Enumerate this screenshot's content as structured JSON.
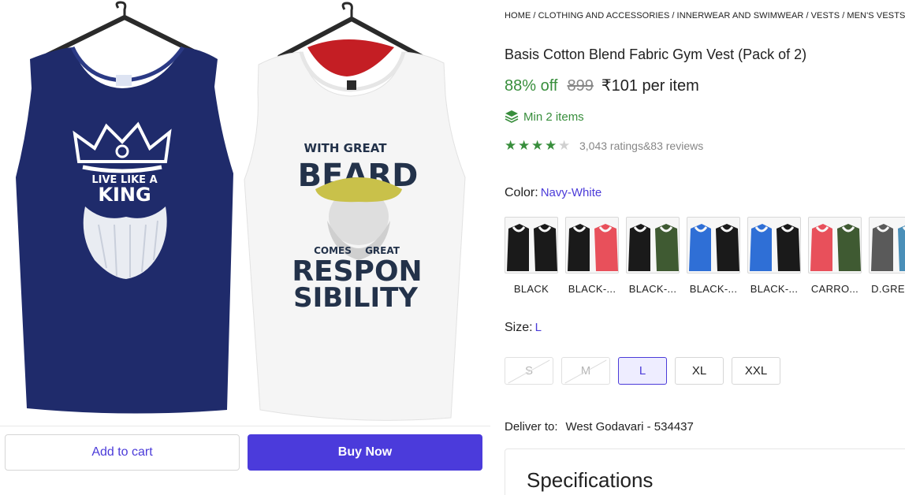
{
  "breadcrumb": [
    {
      "label": "HOME"
    },
    {
      "label": "CLOTHING AND ACCESSORIES"
    },
    {
      "label": "INNERWEAR AND SWIMWEAR"
    },
    {
      "label": "VESTS"
    },
    {
      "label": "MEN'S VESTS"
    }
  ],
  "product": {
    "title": "Basis Cotton Blend Fabric Gym Vest (Pack of 2)",
    "discount": "88% off",
    "mrp": "899",
    "price": "₹101 per item",
    "min_items": "Min 2 items",
    "rating": 4,
    "rating_max": 5,
    "ratings_count": "3,043 ratings",
    "reviews_count": "83 reviews",
    "reviews_prefix": "&"
  },
  "image": {
    "left_vest": {
      "text_top": "LIVE LIKE A",
      "text_bottom": "KING",
      "color": "#1f2b6b"
    },
    "right_vest": {
      "line1": "WITH GREAT",
      "line2": "BEARD",
      "line3": "COMES",
      "line4": "GREAT",
      "line5": "RESPON",
      "line6": "SIBILITY",
      "color": "#f5f5f5"
    }
  },
  "actions": {
    "add_to_cart": "Add to cart",
    "buy_now": "Buy Now"
  },
  "color": {
    "label": "Color:",
    "selected": "Navy-White",
    "options": [
      {
        "label": "BLACK",
        "c1": "#1a1a1a",
        "c2": "#1a1a1a"
      },
      {
        "label": "BLACK-...",
        "c1": "#1a1a1a",
        "c2": "#e8505b"
      },
      {
        "label": "BLACK-...",
        "c1": "#1a1a1a",
        "c2": "#3f5a32"
      },
      {
        "label": "BLACK-...",
        "c1": "#2f6fd6",
        "c2": "#1a1a1a"
      },
      {
        "label": "BLACK-...",
        "c1": "#2f6fd6",
        "c2": "#1a1a1a"
      },
      {
        "label": "CARRO...",
        "c1": "#e8505b",
        "c2": "#3f5a32"
      },
      {
        "label": "D.GREY...",
        "c1": "#5a5a5a",
        "c2": "#4a8fb8"
      }
    ]
  },
  "size": {
    "label": "Size:",
    "selected": "L",
    "options": [
      {
        "label": "S",
        "state": "disabled"
      },
      {
        "label": "M",
        "state": "disabled"
      },
      {
        "label": "L",
        "state": "selected"
      },
      {
        "label": "XL",
        "state": "available"
      },
      {
        "label": "XXL",
        "state": "available"
      }
    ]
  },
  "delivery": {
    "label": "Deliver to:",
    "location": "West Godavari - 534437"
  },
  "specifications": {
    "title": "Specifications"
  },
  "colors": {
    "accent": "#4b3bdb",
    "green": "#388e3c",
    "grey_text": "#878787"
  }
}
